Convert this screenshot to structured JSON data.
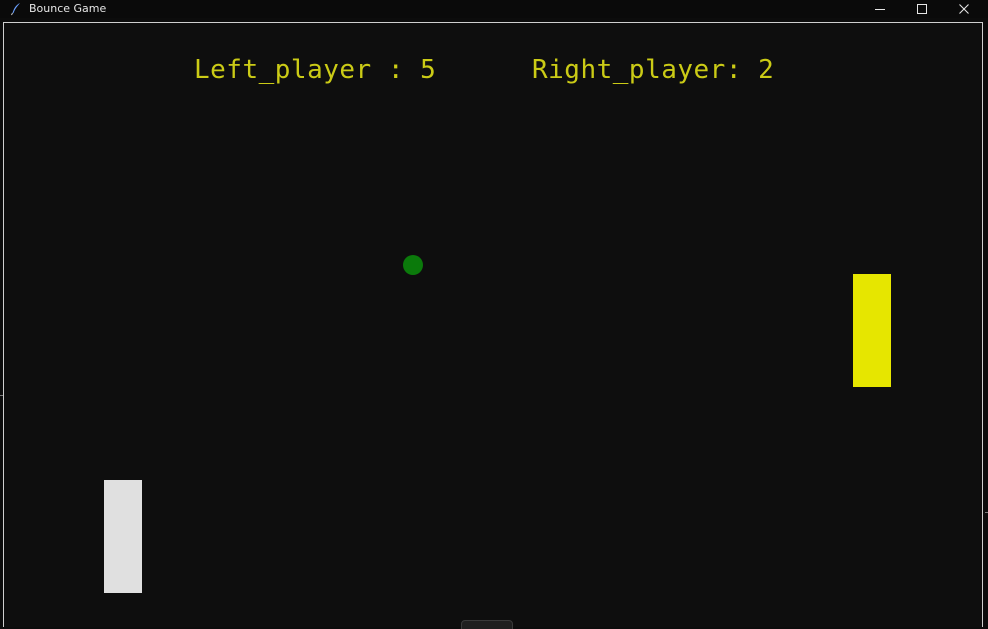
{
  "window": {
    "title": "Bounce Game",
    "icon": "feather-icon",
    "controls": [
      "minimize-icon",
      "maximize-icon",
      "close-icon"
    ]
  },
  "game": {
    "left_label": "Left_player : 5",
    "right_label": "Right_player: 2",
    "left_score": 5,
    "right_score": 2,
    "colors": {
      "background": "#0e0e0e",
      "score_text": "#cbcb16",
      "ball": "#0b7a0b",
      "left_paddle": "#e0e0e0",
      "right_paddle": "#e6e600"
    }
  }
}
